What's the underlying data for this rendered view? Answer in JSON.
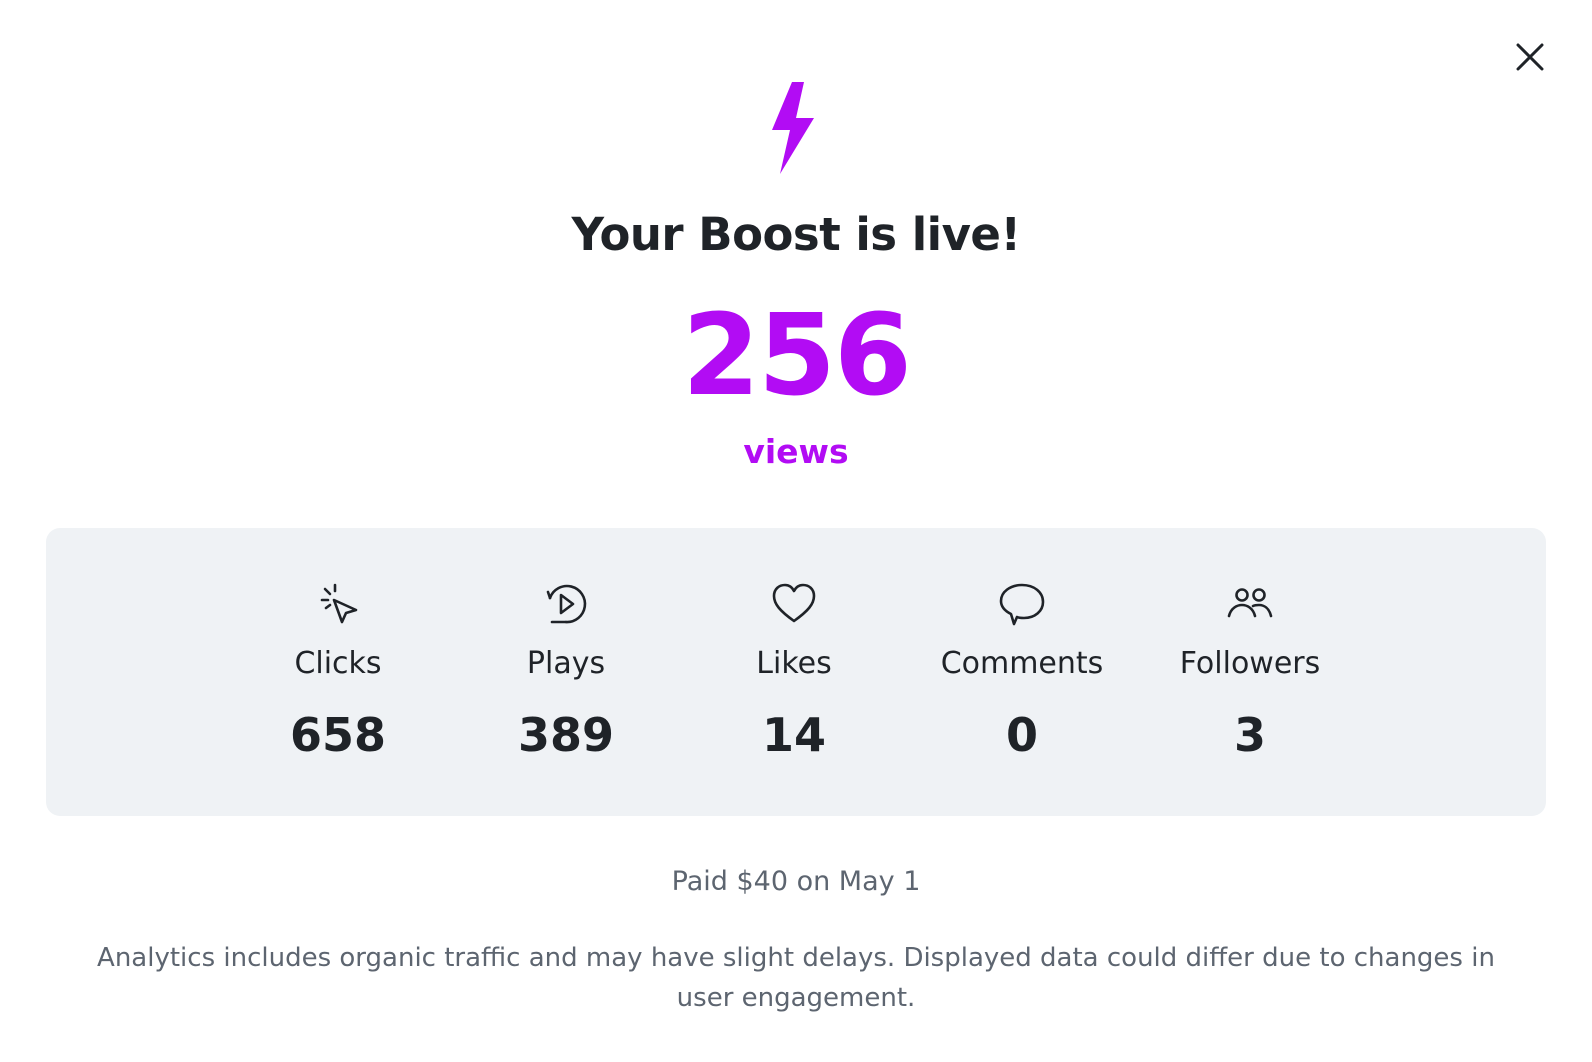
{
  "modal": {
    "title": "Your Boost is live!",
    "headline_metric": {
      "value": "256",
      "label": "views"
    },
    "stats": [
      {
        "label": "Clicks",
        "value": "658",
        "icon": "cursor-click-icon"
      },
      {
        "label": "Plays",
        "value": "389",
        "icon": "play-replay-icon"
      },
      {
        "label": "Likes",
        "value": "14",
        "icon": "heart-icon"
      },
      {
        "label": "Comments",
        "value": "0",
        "icon": "comment-bubble-icon"
      },
      {
        "label": "Followers",
        "value": "3",
        "icon": "followers-icon"
      }
    ],
    "payment_note": "Paid $40 on May 1",
    "disclaimer": "Analytics includes organic traffic and may have slight delays. Displayed data could differ due to changes in user engagement.",
    "close_icon": "close-icon",
    "hero_icon": "lightning-bolt-icon"
  },
  "colors": {
    "accent": "#b20cf4",
    "text_dark": "#1f2328",
    "text_muted": "#5d6570",
    "panel_bg": "#eff2f5",
    "pattern_bolt": "#e6e8ea"
  }
}
